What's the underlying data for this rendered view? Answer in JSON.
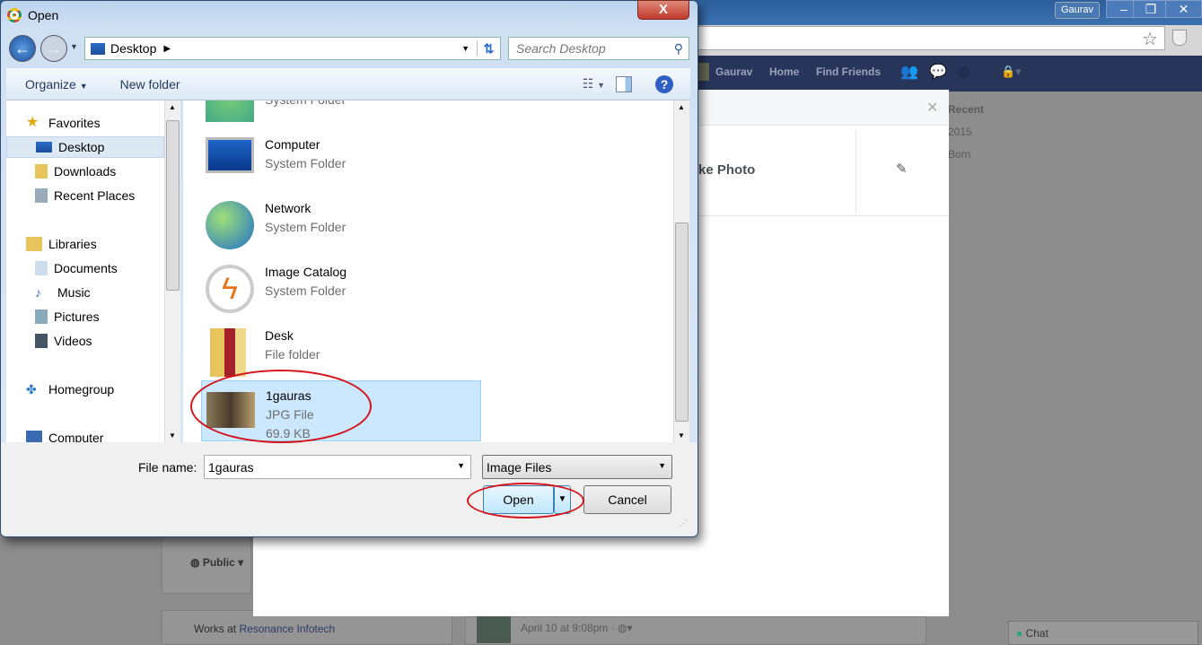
{
  "browser": {
    "profile": "Gaurav",
    "window_controls": [
      "minimize",
      "restore",
      "close"
    ]
  },
  "facebook": {
    "nav": [
      "Gaurav",
      "Home",
      "Find Friends"
    ],
    "sidebar_bits": [
      "Recent",
      "2015",
      "Born"
    ],
    "modal_action": "ke Photo",
    "privacy": "Public",
    "works_at_prefix": "Works at",
    "works_at_link": "Resonance Infotech",
    "post_time": "April 10 at 9:08pm · ",
    "chat": "Chat"
  },
  "dialog": {
    "title": "Open",
    "address": "Desktop",
    "search_placeholder": "Search Desktop",
    "toolbar": {
      "organize": "Organize",
      "new_folder": "New folder"
    },
    "nav": [
      {
        "label": "Favorites",
        "icon": "star-icon"
      },
      {
        "label": "Desktop",
        "icon": "desktop-icon",
        "selected": true
      },
      {
        "label": "Downloads",
        "icon": "downloads-icon"
      },
      {
        "label": "Recent Places",
        "icon": "recent-places-icon"
      },
      {
        "label": "Libraries",
        "icon": "libraries-icon"
      },
      {
        "label": "Documents",
        "icon": "documents-icon"
      },
      {
        "label": "Music",
        "icon": "music-icon"
      },
      {
        "label": "Pictures",
        "icon": "pictures-icon"
      },
      {
        "label": "Videos",
        "icon": "videos-icon"
      },
      {
        "label": "Homegroup",
        "icon": "homegroup-icon"
      },
      {
        "label": "Computer",
        "icon": "computer-icon"
      }
    ],
    "files": [
      {
        "name": "",
        "type": "System Folder"
      },
      {
        "name": "Computer",
        "type": "System Folder"
      },
      {
        "name": "Network",
        "type": "System Folder"
      },
      {
        "name": "Image Catalog",
        "type": "System Folder"
      },
      {
        "name": "Desk",
        "type": "File folder"
      },
      {
        "name": "1gauras",
        "type": "JPG File",
        "size": "69.9 KB",
        "selected": true
      }
    ],
    "file_name_label": "File name:",
    "file_name_value": "1gauras",
    "file_type": "Image Files",
    "open": "Open",
    "cancel": "Cancel"
  },
  "colors": {
    "annotation": "#d4141b",
    "selection": "#cce8ff"
  }
}
